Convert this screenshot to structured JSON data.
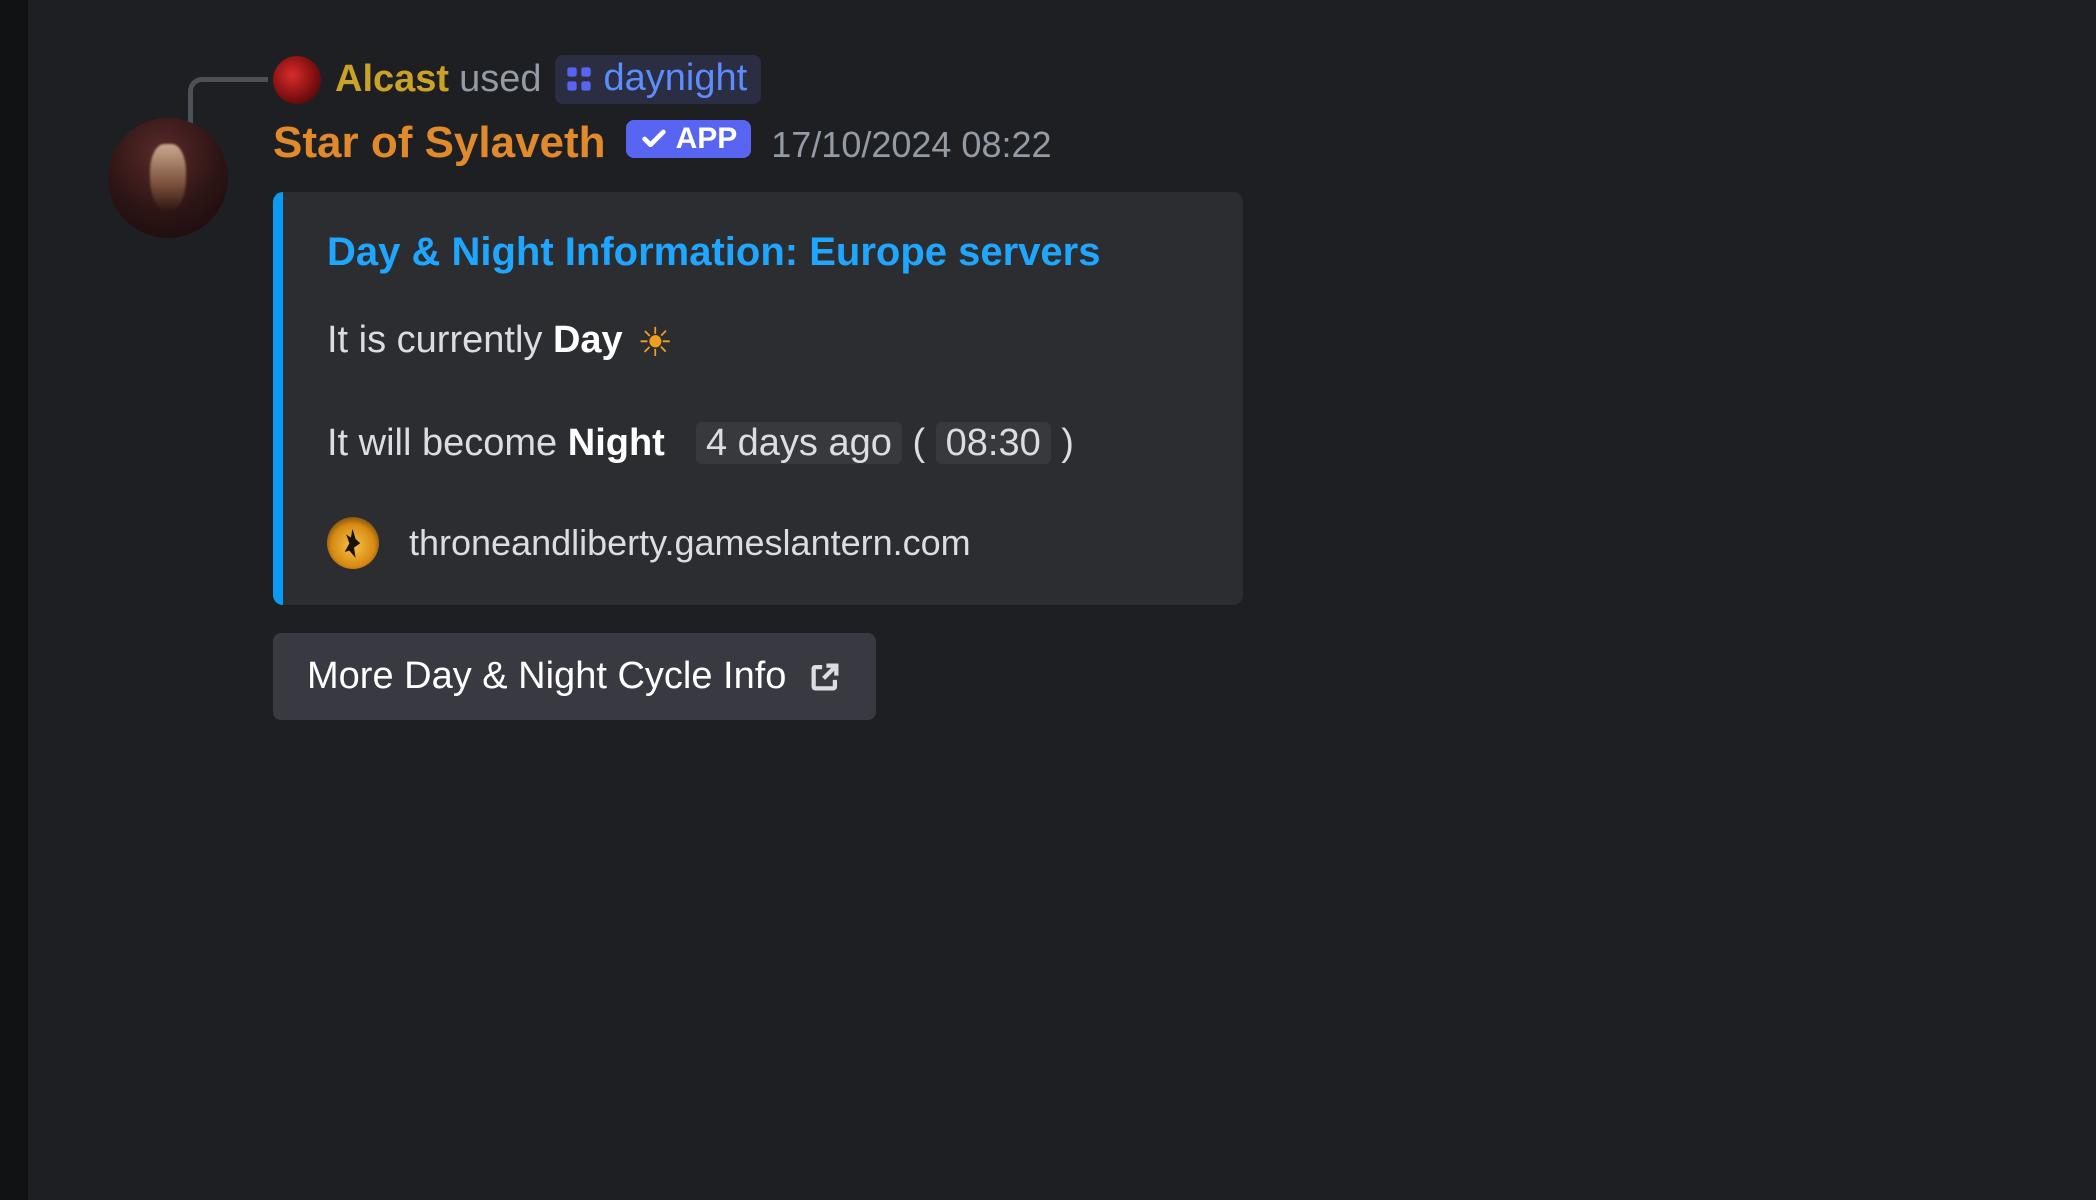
{
  "reply": {
    "username": "Alcast",
    "used_label": "used",
    "command": "daynight"
  },
  "bot": {
    "name": "Star of Sylaveth",
    "app_badge": "APP",
    "timestamp": "17/10/2024 08:22"
  },
  "embed": {
    "title": "Day & Night Information: Europe servers",
    "line1_prefix": "It is currently ",
    "line1_bold": "Day",
    "sun_emoji": "☀",
    "line2_prefix": "It will become ",
    "line2_bold": "Night",
    "line2_rel": "4 days ago",
    "line2_paren_open": " ( ",
    "line2_time": "08:30",
    "line2_paren_close": " )",
    "footer_site": "throneandliberty.gameslantern.com"
  },
  "button": {
    "label": "More Day & Night Cycle Info"
  }
}
